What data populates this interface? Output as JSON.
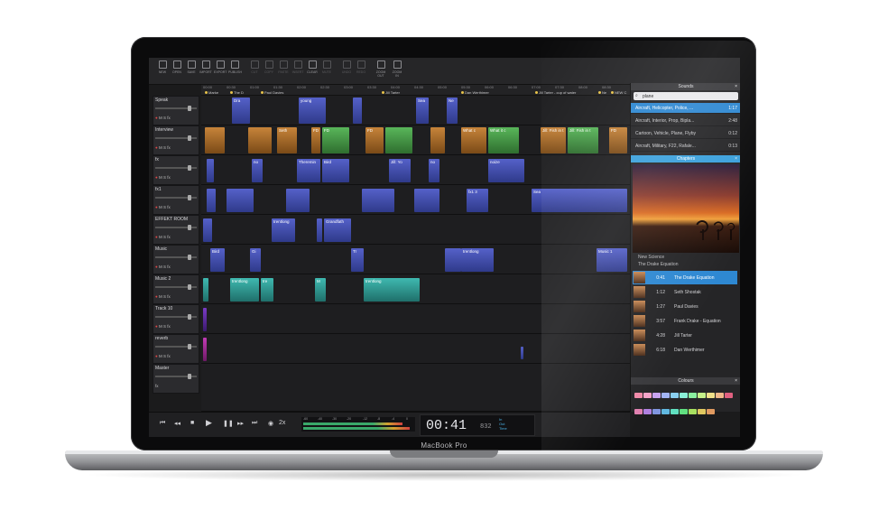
{
  "device": {
    "brand": "MacBook Pro"
  },
  "toolbar": {
    "items": [
      {
        "label": "NEW"
      },
      {
        "label": "OPEN"
      },
      {
        "label": "SAVE"
      },
      {
        "label": "IMPORT"
      },
      {
        "label": "EXPORT"
      },
      {
        "label": "PUBLISH"
      },
      {
        "label": "CUT"
      },
      {
        "label": "COPY"
      },
      {
        "label": "PASTE"
      },
      {
        "label": "INSERT"
      },
      {
        "label": "CLEAR"
      },
      {
        "label": "MUTE"
      },
      {
        "label": "UNDO"
      },
      {
        "label": "REDO"
      },
      {
        "label": "ZOOM OUT"
      },
      {
        "label": "ZOOM IN"
      }
    ]
  },
  "ruler": {
    "ticks": [
      "00:00",
      "00:30",
      "01:00",
      "01:30",
      "02:00",
      "02:30",
      "03:00",
      "03:30",
      "04:00",
      "04:30",
      "05:00",
      "05:30",
      "06:00",
      "06:30",
      "07:00",
      "07:30",
      "08:00",
      "08:30"
    ],
    "markers": [
      "Marke",
      "The D",
      "Paul Davies",
      "Jill Tarter",
      "Dan Werthimer",
      "Jill Tarter - cup of water",
      "Ne",
      "NEW C"
    ]
  },
  "tracks": [
    {
      "name": "Speak"
    },
    {
      "name": "Interview"
    },
    {
      "name": "fx"
    },
    {
      "name": "fx1"
    },
    {
      "name": "EFFEKT ROOM"
    },
    {
      "name": "Music"
    },
    {
      "name": "Music 2"
    },
    {
      "name": "Track 10"
    },
    {
      "name": "reverb"
    },
    {
      "name": "Master"
    }
  ],
  "track_buttons": {
    "rec": "●",
    "mute": "M",
    "solo": "S",
    "fx": "fx"
  },
  "clips": {
    "speak": [
      "Dra",
      "young",
      "Sea",
      "Ne"
    ],
    "interview": [
      "Seth",
      "FD",
      "FD",
      "FD",
      "What c",
      "What it c",
      "Jill: Fish in t",
      "Jill: Fish in t",
      "FD"
    ],
    "fx": [
      "no",
      "Theremin",
      "Bird",
      "Jill: Yo",
      "no",
      "noize"
    ],
    "fx1": [
      "fx1 3",
      "Sea"
    ],
    "effekt": [
      "trentlong",
      "Grandfath"
    ],
    "music": [
      "Bird",
      "Gi",
      "Tr",
      "trentlong",
      "Music 1"
    ],
    "music2": [
      "trentlong",
      "tre",
      "M",
      "trentlong"
    ]
  },
  "transport": {
    "timecode": "00:41",
    "frames": "832",
    "in_label": "In",
    "out_label": "Out",
    "time_label": "Time",
    "speed": "2x",
    "meter_labels": [
      "-60",
      "-40",
      "-30",
      "-20",
      "-12",
      "-8",
      "-4",
      "0"
    ]
  },
  "sounds_panel": {
    "title": "Sounds",
    "search_value": "plane",
    "results": [
      {
        "name": "Aircraft, Helicopter, Police, ...",
        "duration": "1:17",
        "selected": true
      },
      {
        "name": "Aircraft, Interior, Prop, Bipla...",
        "duration": "2:48",
        "selected": false
      },
      {
        "name": "Cartoon, Vehicle, Plane, Flyby",
        "duration": "0:12",
        "selected": false
      },
      {
        "name": "Aircraft, Military, F22, Rafale...",
        "duration": "0:13",
        "selected": false
      }
    ]
  },
  "chapters_panel": {
    "title": "Chapters",
    "show": "New Science",
    "episode": "The Drake Equation",
    "items": [
      {
        "time": "0:41",
        "name": "The Drake Equation",
        "selected": true
      },
      {
        "time": "1:12",
        "name": "Seth Shostak",
        "selected": false
      },
      {
        "time": "1:27",
        "name": "Paul Davies",
        "selected": false
      },
      {
        "time": "3:57",
        "name": "Frank Drake - Equation",
        "selected": false
      },
      {
        "time": "4:28",
        "name": "Jill Tarter",
        "selected": false
      },
      {
        "time": "6:18",
        "name": "Dan Werthimer",
        "selected": false
      }
    ]
  },
  "colours_panel": {
    "title": "Colours",
    "swatches": [
      "#f08aa8",
      "#f5a3c8",
      "#c9a3f0",
      "#a3b5f5",
      "#8ad0f0",
      "#8af0d8",
      "#8af0a0",
      "#c5f08a",
      "#f0e08a",
      "#f0b88a",
      "#e06080",
      "#e080b0",
      "#b080e0",
      "#8096e0",
      "#60b8e0",
      "#60e0c0",
      "#60e080",
      "#a8e060",
      "#e0c860",
      "#e09a60"
    ]
  }
}
